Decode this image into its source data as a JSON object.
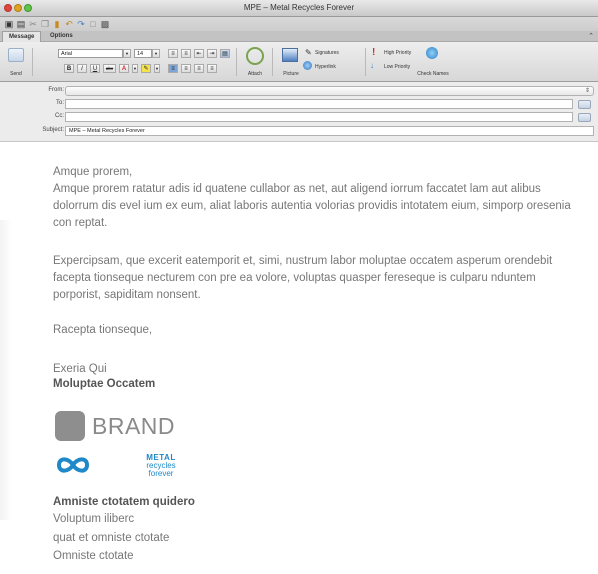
{
  "window": {
    "title": "MPE – Metal Recycles Forever"
  },
  "tabs": [
    {
      "label": "Message"
    },
    {
      "label": "Options"
    }
  ],
  "ribbon": {
    "send_label": "Send",
    "font_name": "Arial",
    "font_size": "14",
    "attach_label": "Attach",
    "picture_label": "Picture",
    "signatures_label": "Signatures",
    "hyperlink_label": "Hyperlink",
    "high_priority_label": "High Priority",
    "low_priority_label": "Low Priority",
    "check_names_label": "Check Names",
    "bold": "B",
    "italic": "I",
    "underline": "U",
    "strike": "abc"
  },
  "headers": {
    "from_label": "From:",
    "to_label": "To:",
    "cc_label": "Cc:",
    "subject_label": "Subject:",
    "from_value": "",
    "to_value": "",
    "cc_value": "",
    "subject_value": "MPE – Metal Recycles Forever"
  },
  "body": {
    "greeting": "Amque prorem,",
    "paragraph1": "Amque prorem ratatur adis id quatene cullabor as net, aut aligend iorrum faccatet lam aut alibus dolorrum dis evel ium ex eum, aliat laboris autentia volorias providis intotatem eium, simporp oresenia con reptat.",
    "paragraph2": "Expercipsam, que excerit eatemporit et, simi, nustrum labor moluptae occatem asperum orendebit facepta tionseque necturem con pre ea volore, voluptas quasper fereseque is culparu nduntem porporist, sapiditam nonsent.",
    "closing": "Racepta tionseque,"
  },
  "signature": {
    "name": "Exeria Qui",
    "title": "Moluptae Occatem",
    "brand": "BRAND",
    "logo_line1": "METAL",
    "logo_line2": "recycles",
    "logo_line3": "forever",
    "company": "Amniste ctotatem quidero",
    "line1": "Voluptum iliberc",
    "line2": "quat et omniste ctotate",
    "line3": "Omniste ctotate"
  },
  "colors": {
    "logo_blue": "#1e88c9",
    "brand_gray": "#8e8e8e"
  }
}
